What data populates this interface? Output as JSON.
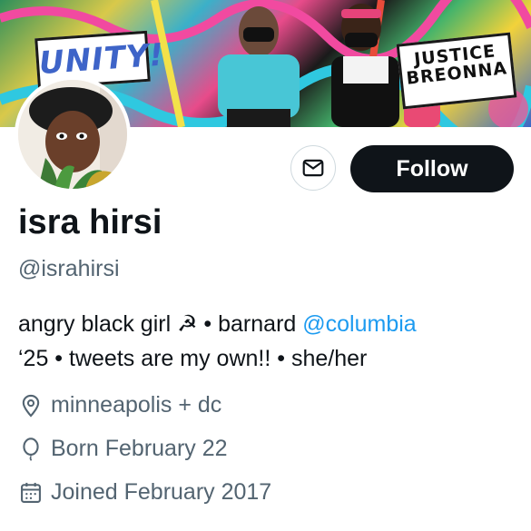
{
  "banner": {
    "sign_left": "UNITY!",
    "sign_right_line1": "JUSTICE",
    "sign_right_line2": "BREONNA"
  },
  "actions": {
    "message_icon": "envelope-icon",
    "follow_label": "Follow"
  },
  "profile": {
    "name": "isra hirsi",
    "handle": "@israhirsi",
    "bio_part1": "angry black girl ☭ • barnard ",
    "bio_mention": "@columbia",
    "bio_part2": "‘25 • tweets are my own!! • she/her",
    "location": "minneapolis + dc",
    "birthday": "Born February 22",
    "joined": "Joined February 2017"
  },
  "icons": {
    "location": "location-pin-icon",
    "birthday": "balloon-icon",
    "joined": "calendar-icon"
  },
  "colors": {
    "primary_text": "#0f1419",
    "secondary_text": "#536471",
    "link": "#1d9bf0",
    "follow_bg": "#0f1419"
  }
}
